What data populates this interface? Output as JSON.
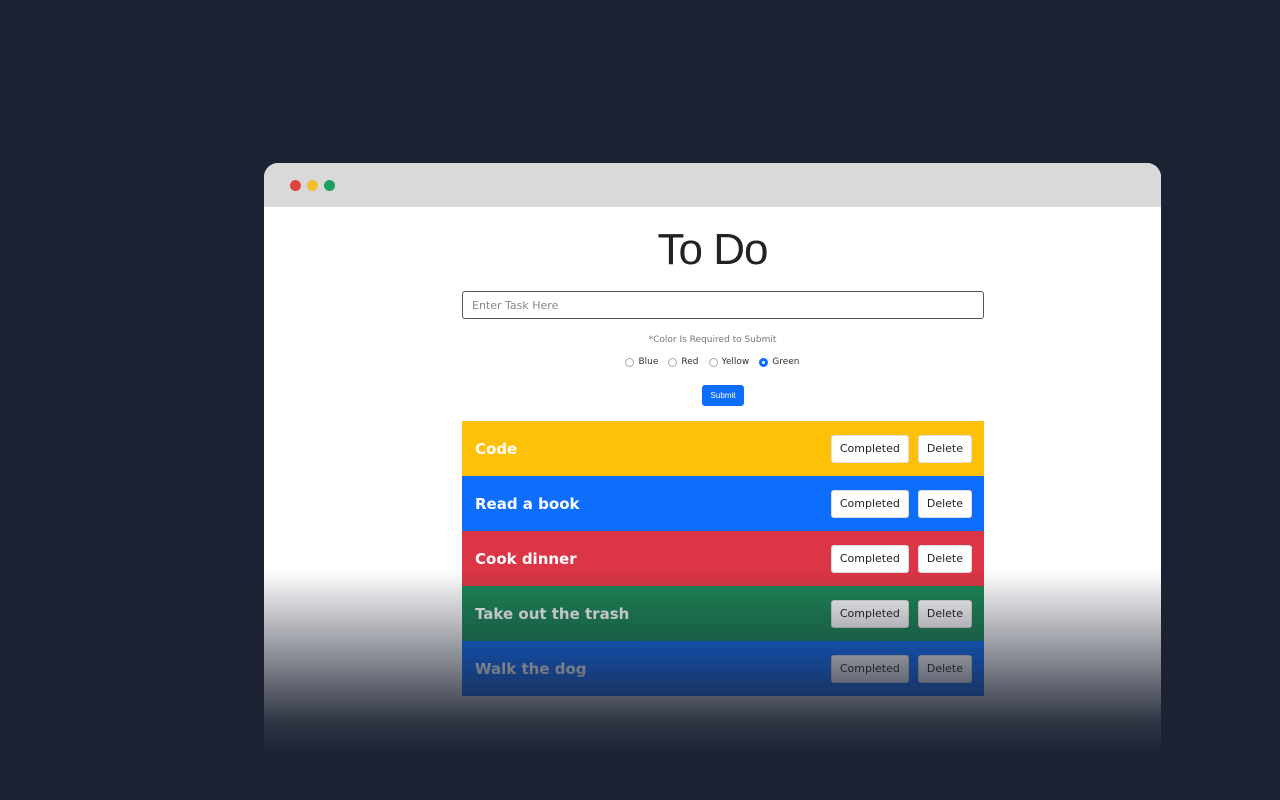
{
  "window": {
    "dots": [
      "#e0443e",
      "#f4be2c",
      "#1aa260"
    ]
  },
  "app": {
    "title": "To Do",
    "input_placeholder": "Enter Task Here",
    "note": "*Color Is Required to Submit",
    "colors": [
      {
        "label": "Blue",
        "checked": false
      },
      {
        "label": "Red",
        "checked": false
      },
      {
        "label": "Yellow",
        "checked": false
      },
      {
        "label": "Green",
        "checked": true
      }
    ],
    "submit_label": "Submit"
  },
  "tasks": [
    {
      "name": "Code",
      "color": "#ffc107",
      "completed_label": "Completed",
      "delete_label": "Delete"
    },
    {
      "name": "Read a book",
      "color": "#0d6efd",
      "completed_label": "Completed",
      "delete_label": "Delete"
    },
    {
      "name": "Cook dinner",
      "color": "#dc3545",
      "completed_label": "Completed",
      "delete_label": "Delete"
    },
    {
      "name": "Take out the trash",
      "color": "#198754",
      "completed_label": "Completed",
      "delete_label": "Delete"
    },
    {
      "name": "Walk the dog",
      "color": "#0d6efd",
      "completed_label": "Completed",
      "delete_label": "Delete"
    }
  ]
}
